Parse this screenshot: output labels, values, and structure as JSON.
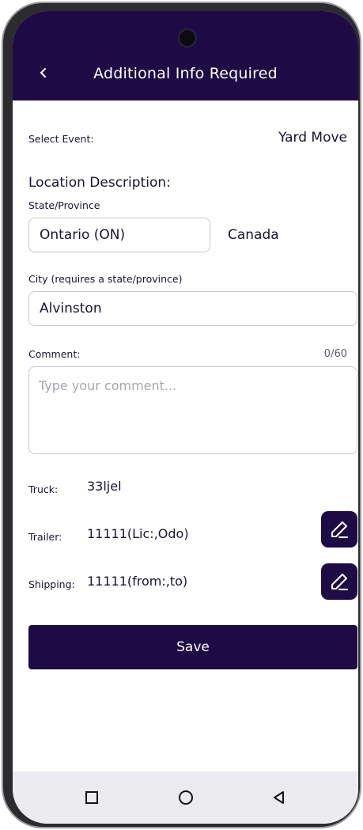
{
  "header": {
    "title": "Additional Info Required",
    "back_icon": "chevron-left-icon"
  },
  "form": {
    "select_event_label": "Select Event:",
    "select_event_value": "Yard Move",
    "location_section_title": "Location Description:",
    "state_label": "State/Province",
    "state_value": "Ontario (ON)",
    "country_value": "Canada",
    "city_label": "City (requires a state/province)",
    "city_value": "Alvinston",
    "comment_label": "Comment:",
    "comment_counter": "0/60",
    "comment_placeholder": "Type your comment..."
  },
  "info": {
    "truck_label": "Truck:",
    "truck_value": "33ljel",
    "trailer_label": "Trailer:",
    "trailer_value": "11111(Lic:,Odo)",
    "shipping_label": "Shipping:",
    "shipping_value": "11111(from:,to)",
    "edit_icon": "pencil-icon"
  },
  "actions": {
    "save_label": "Save"
  },
  "nav": {
    "recents_icon": "square-icon",
    "home_icon": "circle-icon",
    "back_icon": "triangle-back-icon"
  },
  "colors": {
    "brand": "#1e0b45",
    "border": "#c8c8cc",
    "placeholder": "#a7a7ad",
    "navbar": "#ecebf0"
  }
}
